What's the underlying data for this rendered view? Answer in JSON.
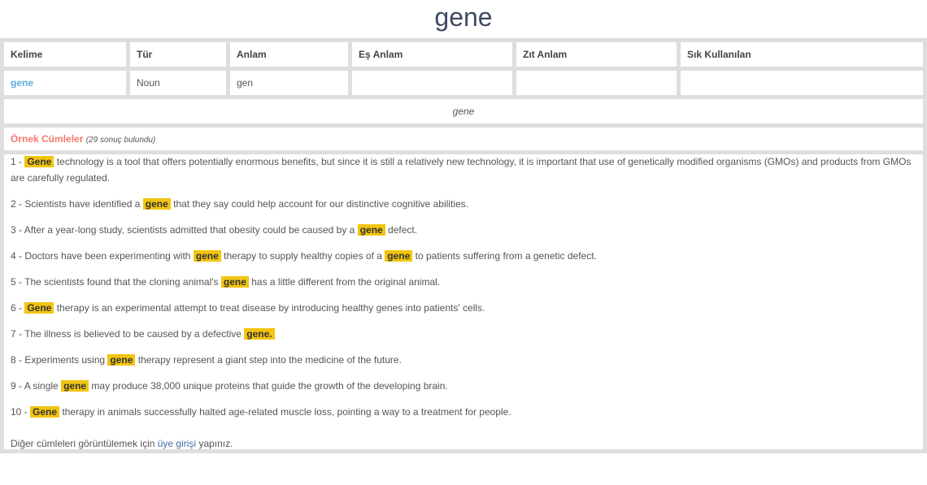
{
  "page_title": "gene",
  "table": {
    "headers": [
      "Kelime",
      "Tür",
      "Anlam",
      "Eş Anlam",
      "Zıt Anlam",
      "Sık Kullanılan"
    ],
    "row": [
      "gene",
      "Noun",
      "gen",
      "",
      "",
      ""
    ]
  },
  "definition_row": "gene",
  "examples": {
    "label": "Örnek Cümleler",
    "count_text": "(29 sonuç bulundu)",
    "highlight_color": "#f2c40f",
    "sentences": [
      {
        "num": "1 - ",
        "before": "",
        "hl": "Gene",
        "after": " technology is a tool that offers potentially enormous benefits, but since it is still a relatively new technology, it is important that use of genetically modified organisms (GMOs) and products from GMOs are carefully regulated."
      },
      {
        "num": "2 - ",
        "before": "Scientists have identified a ",
        "hl": "gene",
        "after": " that they say could help account for our distinctive cognitive abilities."
      },
      {
        "num": "3 - ",
        "before": "After a year-long study, scientists admitted that obesity could be caused by a ",
        "hl": "gene",
        "after": " defect."
      },
      {
        "num": "4 - ",
        "before": "Doctors have been experimenting with ",
        "hl": "gene",
        "mid": " therapy to supply healthy copies of a ",
        "hl2": "gene",
        "after": " to patients suffering from a genetic defect."
      },
      {
        "num": "5 - ",
        "before": "The scientists found that the cloning animal's ",
        "hl": "gene",
        "after": " has a little different from the original animal."
      },
      {
        "num": "6 - ",
        "before": "",
        "hl": "Gene",
        "after": " therapy is an experimental attempt to treat disease by introducing healthy genes into patients' cells."
      },
      {
        "num": "7 - ",
        "before": "The illness is believed to be caused by a defective ",
        "hl": "gene.",
        "after": ""
      },
      {
        "num": "8 - ",
        "before": "Experiments using ",
        "hl": "gene",
        "after": " therapy represent a giant step into the medicine of the future."
      },
      {
        "num": "9 - ",
        "before": "A single ",
        "hl": "gene",
        "after": " may produce 38,000 unique proteins that guide the growth of the developing brain."
      },
      {
        "num": "10 - ",
        "before": "",
        "hl": "Gene",
        "after": " therapy in animals successfully halted age-related muscle loss, pointing a way to a treatment for people."
      }
    ],
    "footer": {
      "before": "Diğer cümleleri görüntülemek için ",
      "link": "üye girişi",
      "after": " yapınız."
    }
  }
}
